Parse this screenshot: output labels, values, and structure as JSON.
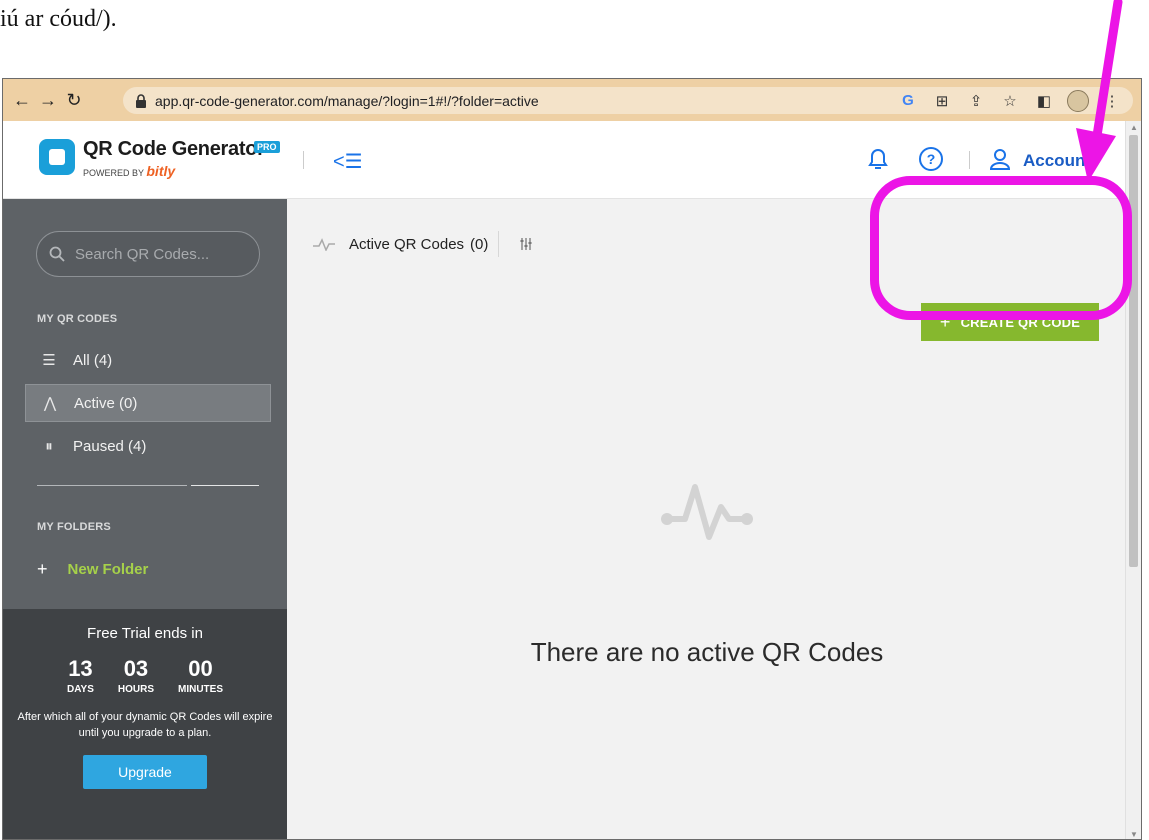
{
  "caption": "iú ar cóud/).",
  "browser": {
    "url": "app.qr-code-generator.com/manage/?login=1#!/?folder=active",
    "back_icon": "back-arrow-icon",
    "forward_icon": "forward-arrow-icon",
    "reload_icon": "reload-icon"
  },
  "header": {
    "logo_title": "QR Code Generator",
    "pro_badge": "PRO",
    "powered_by": "POWERED BY",
    "bitly": "bitly",
    "account_label": "Account",
    "help_symbol": "?"
  },
  "sidebar": {
    "search_placeholder": "Search QR Codes...",
    "my_qr_codes_label": "MY QR CODES",
    "items": [
      {
        "label": "All (4)",
        "icon": "list-icon",
        "symbol": "☰"
      },
      {
        "label": "Active (0)",
        "icon": "pulse-icon",
        "symbol": "⋀"
      },
      {
        "label": "Paused (4)",
        "icon": "pause-icon",
        "symbol": "⏸"
      }
    ],
    "my_folders_label": "MY FOLDERS",
    "new_folder_label": "New Folder",
    "new_folder_symbol": "+"
  },
  "trial": {
    "title": "Free Trial ends in",
    "countdown": [
      {
        "value": "13",
        "unit": "DAYS"
      },
      {
        "value": "03",
        "unit": "HOURS"
      },
      {
        "value": "00",
        "unit": "MINUTES"
      }
    ],
    "note": "After which all of your dynamic QR Codes will expire until you upgrade to a plan.",
    "upgrade_label": "Upgrade"
  },
  "main": {
    "title": "Active QR Codes",
    "count": "(0)",
    "create_symbol": "+",
    "create_label": "CREATE QR CODE",
    "empty_message": "There are no active QR Codes"
  },
  "colors": {
    "accent_green": "#86b82e",
    "brand_blue": "#1a9fd9",
    "annotation_magenta": "#ec15e6",
    "sidebar_bg": "#5e6266"
  }
}
